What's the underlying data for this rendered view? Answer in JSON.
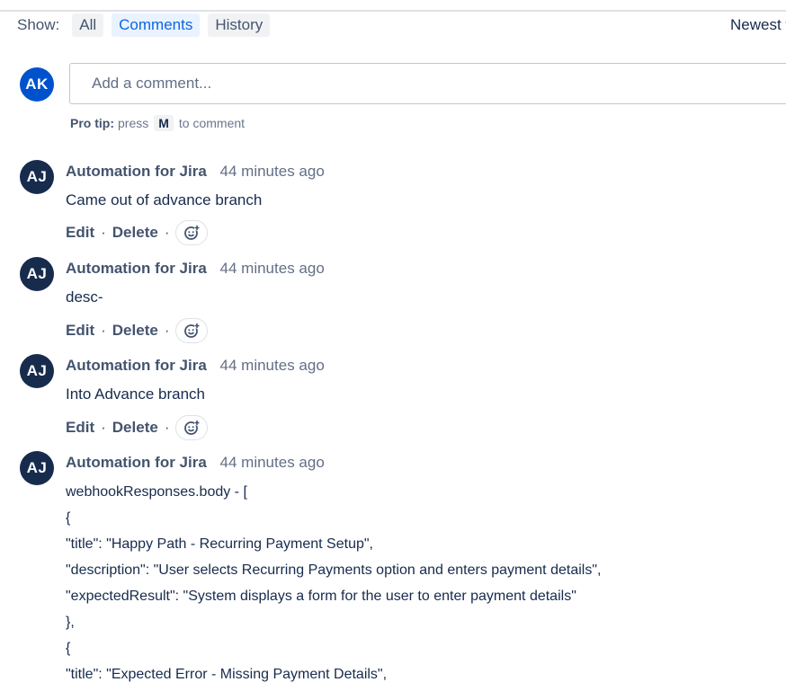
{
  "filters": {
    "show_label": "Show:",
    "options": [
      "All",
      "Comments",
      "History"
    ],
    "active": "Comments",
    "sort_label": "Newest first"
  },
  "new_comment": {
    "avatar_initials": "AK",
    "placeholder": "Add a comment...",
    "pro_tip_label": "Pro tip:",
    "pro_tip_press": "press",
    "pro_tip_key": "M",
    "pro_tip_suffix": "to comment"
  },
  "comments": [
    {
      "avatar_initials": "AJ",
      "author": "Automation for Jira",
      "time": "44 minutes ago",
      "body": "Came out of advance branch",
      "edit": "Edit",
      "delete": "Delete"
    },
    {
      "avatar_initials": "AJ",
      "author": "Automation for Jira",
      "time": "44 minutes ago",
      "body": "desc-",
      "edit": "Edit",
      "delete": "Delete"
    },
    {
      "avatar_initials": "AJ",
      "author": "Automation for Jira",
      "time": "44 minutes ago",
      "body": "Into Advance branch",
      "edit": "Edit",
      "delete": "Delete"
    },
    {
      "avatar_initials": "AJ",
      "author": "Automation for Jira",
      "time": "44 minutes ago",
      "body_lines": [
        "webhookResponses.body - [",
        "{",
        "\"title\": \"Happy Path - Recurring Payment Setup\",",
        "\"description\": \"User selects Recurring Payments option and enters payment details\",",
        "\"expectedResult\": \"System displays a form for the user to enter payment details\"",
        "},",
        "{",
        "\"title\": \"Expected Error - Missing Payment Details\","
      ]
    }
  ],
  "colors": {
    "user_avatar": "#0052cc",
    "bot_avatar": "#172b4d",
    "active_filter_text": "#0c66e4",
    "active_filter_bg": "#e9f2ff"
  }
}
